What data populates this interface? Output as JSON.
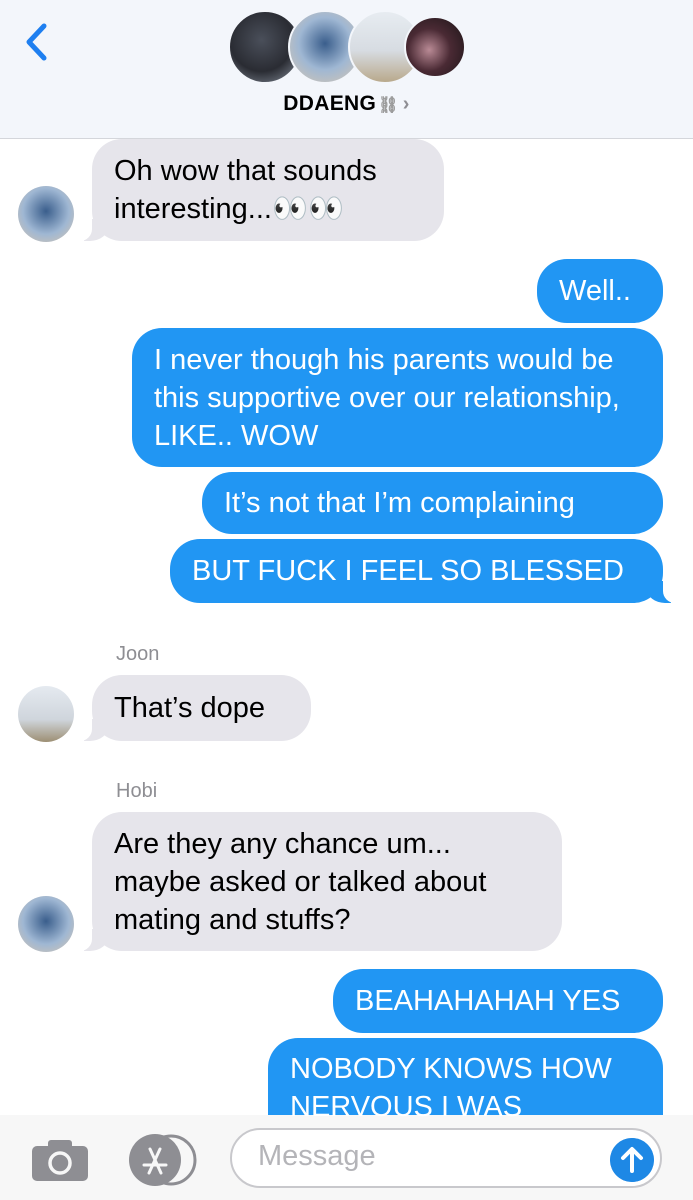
{
  "header": {
    "group_name": "DDAENG",
    "chain_glyph": "⛓",
    "chevron": "›",
    "avatars": [
      "avatar-1",
      "avatar-2",
      "avatar-3",
      "avatar-4"
    ]
  },
  "messages": [
    {
      "direction": "in",
      "text": "Oh wow that sounds interesting...👀👀"
    },
    {
      "direction": "out",
      "text": "Well.."
    },
    {
      "direction": "out",
      "text": "I never though his parents would be this supportive over our relationship, LIKE.. WOW"
    },
    {
      "direction": "out",
      "text": "It’s not that I’m complaining"
    },
    {
      "direction": "out",
      "text": "BUT FUCK I FEEL SO BLESSED"
    },
    {
      "direction": "in",
      "sender": "Joon",
      "text": "That’s dope"
    },
    {
      "direction": "in",
      "sender": "Hobi",
      "text": "Are they any chance um... maybe asked or talked about mating and stuffs?"
    },
    {
      "direction": "out",
      "text": "BEAHAHAHAH YES"
    },
    {
      "direction": "out",
      "text": "NOBODY KNOWS HOW NERVOUS I WAS"
    }
  ],
  "composer": {
    "placeholder": "Message"
  },
  "colors": {
    "outgoing": "#2196f3",
    "incoming": "#e6e5eb",
    "accent": "#1e88e5"
  }
}
